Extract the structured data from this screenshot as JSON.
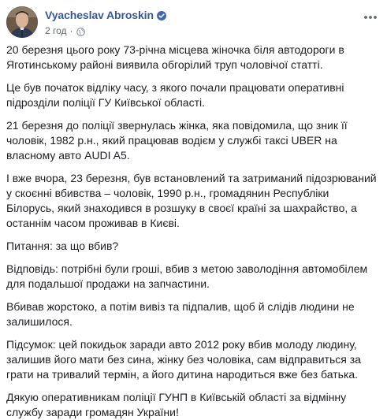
{
  "post": {
    "author": {
      "name": "Vyacheslav Abroskin",
      "verified_icon": "verified-badge-icon",
      "avatar_icon": "profile-avatar"
    },
    "meta": {
      "time": "2 год",
      "separator": "·",
      "privacy_icon": "globe-icon"
    },
    "menu_icon": "more-options-icon",
    "paragraphs": [
      "20 березня цього року 73-річна місцева жіночка біля автодороги в Яготинському районі виявила обгорілий труп чоловічої статті.",
      "Це був початок відліку часу, з якого почали працювати оперативні підрозділи поліції ГУ Київської області.",
      "21 березня до поліції звернулась жінка, яка повідомила, що зник її чоловік, 1982 р.н., який працював водієм у службі таксі UBER на власному авто AUDI A5.",
      "І вже вчора, 23 березня, був встановлений та затриманий підозрюваний у скоєнні вбивства – чоловік, 1990 р.н., громадянин Республіки Білорусь, який знаходився в розшуку в своєї країні за шахрайство, а останнім часом проживав в Києві.",
      "Питання: за що вбив?",
      "Відповідь: потрібні були гроші, вбив з метою заволодіння автомобілем для подальшої продажи на запчастини.",
      "Вбивав жорстоко, а потім вивіз та підпалив, щоб й слідів людини не залишилося.",
      "Підсумок: цей покидьок заради авто 2012 року вбив молоду людину, залишив його мати без сина, жінку без чоловіка, сам відправиться за грати на тривалий термін, а його дитина народиться вже без батька.",
      "Дякую оперативникам поліції ГУНП в Київській області за відмінну службу заради громадян України!"
    ]
  },
  "colors": {
    "name_link": "#385898",
    "text": "#1c1e21",
    "meta": "#616770",
    "verified": "#4267b2"
  }
}
